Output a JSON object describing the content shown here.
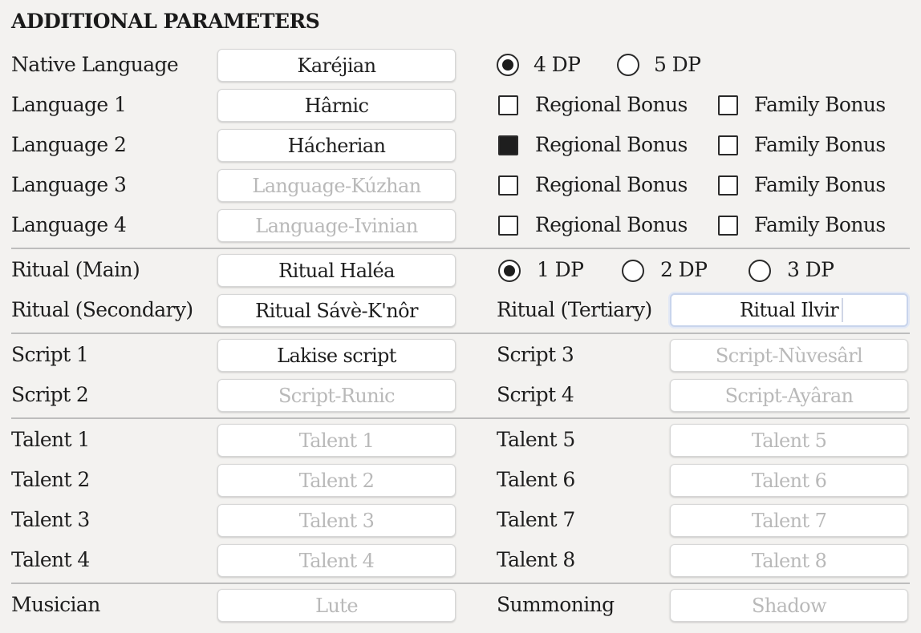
{
  "heading": "ADDITIONAL PARAMETERS",
  "native_language": {
    "label": "Native Language",
    "value": "Karéjian",
    "options": [
      {
        "label": "4 DP",
        "selected": true
      },
      {
        "label": "5 DP",
        "selected": false
      }
    ]
  },
  "languages": [
    {
      "label": "Language 1",
      "value": "Hârnic",
      "placeholder": "",
      "regional_label": "Regional Bonus",
      "regional": false,
      "family_label": "Family Bonus",
      "family": false
    },
    {
      "label": "Language 2",
      "value": "Hácherian",
      "placeholder": "",
      "regional_label": "Regional Bonus",
      "regional": true,
      "family_label": "Family Bonus",
      "family": false
    },
    {
      "label": "Language 3",
      "value": "",
      "placeholder": "Language-Kúzhan",
      "regional_label": "Regional Bonus",
      "regional": false,
      "family_label": "Family Bonus",
      "family": false
    },
    {
      "label": "Language 4",
      "value": "",
      "placeholder": "Language-Ivinian",
      "regional_label": "Regional Bonus",
      "regional": false,
      "family_label": "Family Bonus",
      "family": false
    }
  ],
  "ritual_main": {
    "label": "Ritual (Main)",
    "value": "Ritual Haléa",
    "options": [
      {
        "label": "1 DP",
        "selected": true
      },
      {
        "label": "2 DP",
        "selected": false
      },
      {
        "label": "3 DP",
        "selected": false
      }
    ]
  },
  "ritual_secondary": {
    "label": "Ritual (Secondary)",
    "value": "Ritual Sávè-K'nôr"
  },
  "ritual_tertiary": {
    "label": "Ritual (Tertiary)",
    "value": "Ritual Ilvir"
  },
  "scripts": {
    "s1": {
      "label": "Script 1",
      "value": "Lakise script",
      "placeholder": ""
    },
    "s2": {
      "label": "Script 2",
      "value": "",
      "placeholder": "Script-Runic"
    },
    "s3": {
      "label": "Script 3",
      "value": "",
      "placeholder": "Script-Nùvesârl"
    },
    "s4": {
      "label": "Script 4",
      "value": "",
      "placeholder": "Script-Ayâran"
    }
  },
  "talents": {
    "t1": {
      "label": "Talent 1",
      "placeholder": "Talent 1"
    },
    "t2": {
      "label": "Talent 2",
      "placeholder": "Talent 2"
    },
    "t3": {
      "label": "Talent 3",
      "placeholder": "Talent 3"
    },
    "t4": {
      "label": "Talent 4",
      "placeholder": "Talent 4"
    },
    "t5": {
      "label": "Talent 5",
      "placeholder": "Talent 5"
    },
    "t6": {
      "label": "Talent 6",
      "placeholder": "Talent 6"
    },
    "t7": {
      "label": "Talent 7",
      "placeholder": "Talent 7"
    },
    "t8": {
      "label": "Talent 8",
      "placeholder": "Talent 8"
    }
  },
  "musician": {
    "label": "Musician",
    "placeholder": "Lute"
  },
  "summoning": {
    "label": "Summoning",
    "placeholder": "Shadow"
  }
}
